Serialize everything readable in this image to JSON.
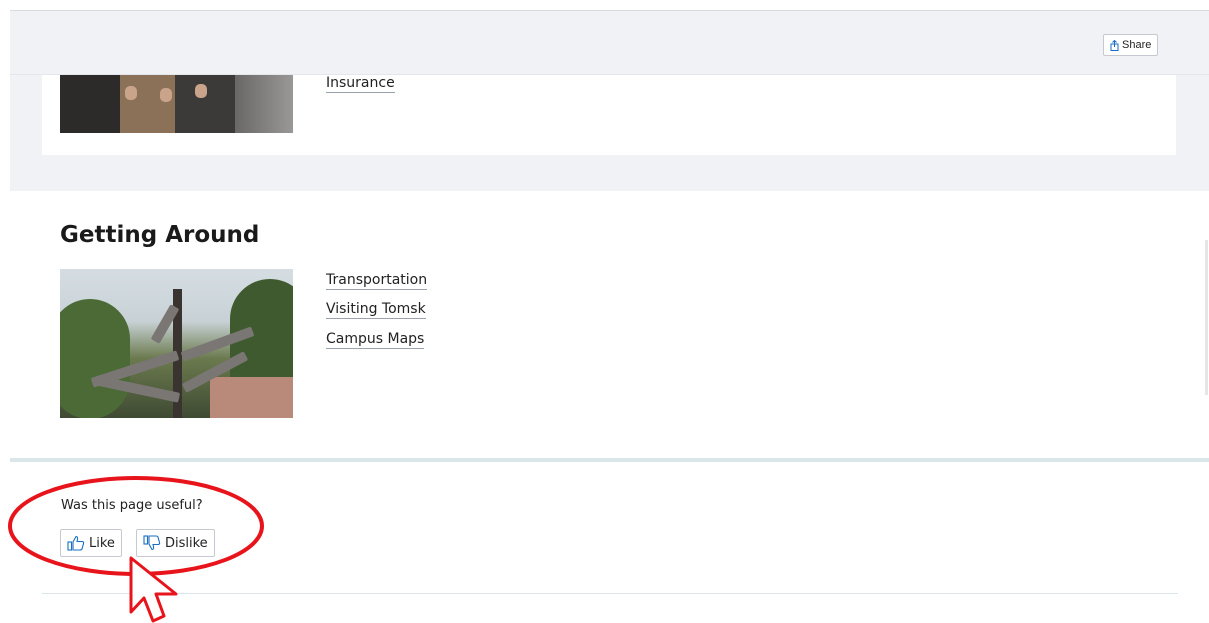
{
  "header": {
    "share_label": "Share"
  },
  "insurance_section": {
    "links": [
      "Insurance"
    ]
  },
  "getting_around": {
    "title": "Getting Around",
    "links": [
      "Transportation",
      "Visiting Tomsk",
      "Campus Maps"
    ]
  },
  "feedback": {
    "question": "Was this page useful?",
    "like_label": "Like",
    "dislike_label": "Dislike"
  },
  "colors": {
    "annotation": "#e8141c",
    "band": "#f0f2f5",
    "accent_blue": "#1a6fc2"
  },
  "icons": {
    "share": "share-icon",
    "like": "thumbs-up-icon",
    "dislike": "thumbs-down-icon",
    "cursor": "cursor-arrow-icon"
  }
}
